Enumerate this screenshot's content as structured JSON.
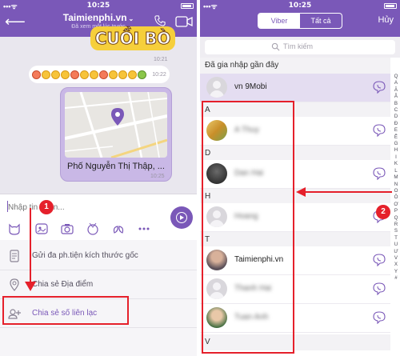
{
  "left": {
    "status_time": "10:25",
    "header": {
      "title": "Taimienphi.vn",
      "subtitle": "Đã xem một lúc trước"
    },
    "sticker_text": "CUỒI BÒ",
    "timestamps": [
      "10:21",
      "10:22",
      "10:25"
    ],
    "map_caption": "Phố Nguyễn Thị Thập, ...",
    "input_placeholder": "Nhập tin nhắn...",
    "menu": {
      "items": [
        {
          "label": "Gửi đa ph.tiện kích thước gốc",
          "icon": "document-icon"
        },
        {
          "label": "Chia sẻ Địa điểm",
          "icon": "location-pin-icon"
        },
        {
          "label": "Chia sẻ số liên lạc",
          "icon": "add-contact-icon"
        }
      ]
    },
    "badge": "1"
  },
  "right": {
    "status_time": "10:25",
    "tabs": [
      {
        "label": "Viber",
        "active": true
      },
      {
        "label": "Tất cả",
        "active": false
      }
    ],
    "cancel": "Hủy",
    "search_placeholder": "Tìm kiếm",
    "recent_header": "Đã gia nhập gần đây",
    "recent_contact": "vn 9Mobi",
    "sections": [
      {
        "letter": "A",
        "contacts": [
          {
            "name": "A Thuy",
            "blurred": true
          }
        ]
      },
      {
        "letter": "D",
        "contacts": [
          {
            "name": "Dan Hai",
            "blurred": true
          }
        ]
      },
      {
        "letter": "H",
        "contacts": [
          {
            "name": "Hoang",
            "blurred": true
          }
        ]
      },
      {
        "letter": "T",
        "contacts": [
          {
            "name": "Taimienphi.vn",
            "blurred": false
          },
          {
            "name": "Thanh Hai",
            "blurred": true
          },
          {
            "name": "Tuan Anh",
            "blurred": true
          }
        ]
      },
      {
        "letter": "V",
        "contacts": []
      }
    ],
    "alphabet": [
      "Q",
      "A",
      "Ă",
      "Â",
      "B",
      "C",
      "D",
      "Đ",
      "E",
      "Ê",
      "G",
      "H",
      "I",
      "K",
      "L",
      "M",
      "N",
      "O",
      "Ô",
      "Ơ",
      "P",
      "Q",
      "R",
      "S",
      "T",
      "U",
      "Ư",
      "V",
      "X",
      "Y",
      "#"
    ],
    "badge": "2"
  },
  "colors": {
    "viber_purple": "#7a58b8",
    "annotation_red": "#e5202b"
  }
}
